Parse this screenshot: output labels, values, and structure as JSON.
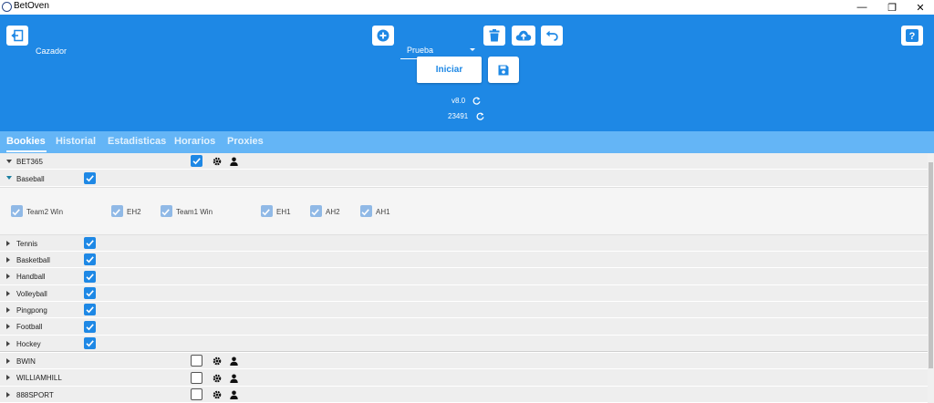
{
  "app": {
    "title": "BetOven"
  },
  "window_controls": {
    "minimize": "—",
    "restore": "❐",
    "close": "✕"
  },
  "header": {
    "profile_label": "Cazador",
    "profile_select": "Prueba",
    "start_button": "Iniciar",
    "version": "v8.0",
    "build": "23491"
  },
  "tabs": [
    "Bookies",
    "Historial",
    "Estadisticas",
    "Horarios",
    "Proxies"
  ],
  "bookies": [
    {
      "name": "BET365",
      "enabled": true,
      "expanded": true
    },
    {
      "name": "BWIN",
      "enabled": false,
      "expanded": false
    },
    {
      "name": "WILLIAMHILL",
      "enabled": false,
      "expanded": false
    },
    {
      "name": "888SPORT",
      "enabled": false,
      "expanded": false
    }
  ],
  "sports": [
    {
      "name": "Baseball",
      "checked": true,
      "expanded": true
    },
    {
      "name": "Tennis",
      "checked": true
    },
    {
      "name": "Basketball",
      "checked": true
    },
    {
      "name": "Handball",
      "checked": true
    },
    {
      "name": "Volleyball",
      "checked": true
    },
    {
      "name": "Pingpong",
      "checked": true
    },
    {
      "name": "Football",
      "checked": true
    },
    {
      "name": "Hockey",
      "checked": true
    }
  ],
  "markets": [
    "Team2 Win",
    "EH2",
    "Team1 Win",
    "EH1",
    "AH2",
    "AH1"
  ],
  "colors": {
    "primary": "#1e88e5",
    "tabbar": "#64b5f6",
    "row": "#eeeeee"
  }
}
